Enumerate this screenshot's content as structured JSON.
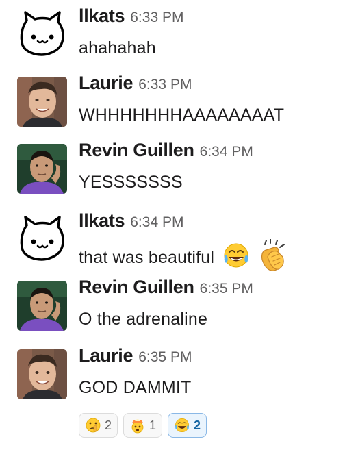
{
  "messages": [
    {
      "author": "llkats",
      "time": "6:33 PM",
      "text": "ahahahah",
      "avatar": "cat-avatar"
    },
    {
      "author": "Laurie",
      "time": "6:33 PM",
      "text": "WHHHHHHHAAAAAAAAT",
      "avatar": "photo-avatar-laurie"
    },
    {
      "author": "Revin Guillen",
      "time": "6:34 PM",
      "text": "YESSSSSSS",
      "avatar": "photo-avatar-revin"
    },
    {
      "author": "llkats",
      "time": "6:34 PM",
      "text": "that was beautiful",
      "avatar": "cat-avatar",
      "emojis": [
        "joy-emoji",
        "clap-emoji"
      ]
    },
    {
      "author": "Revin Guillen",
      "time": "6:35 PM",
      "text": "O the adrenaline",
      "avatar": "photo-avatar-revin"
    },
    {
      "author": "Laurie",
      "time": "6:35 PM",
      "text": "GOD DAMMIT",
      "avatar": "photo-avatar-laurie"
    }
  ],
  "reactions": [
    {
      "emoji": "shushing-face-emoji",
      "count": "2",
      "active": false
    },
    {
      "emoji": "exploding-head-emoji",
      "count": "1",
      "active": false
    },
    {
      "emoji": "joy-emoji",
      "count": "2",
      "active": true
    }
  ],
  "colors": {
    "author": "#1d1c1d",
    "timestamp": "#616061",
    "reaction_active_border": "#8ab8e6",
    "reaction_active_bg": "#eaf4fd",
    "reaction_active_text": "#1264a3"
  }
}
